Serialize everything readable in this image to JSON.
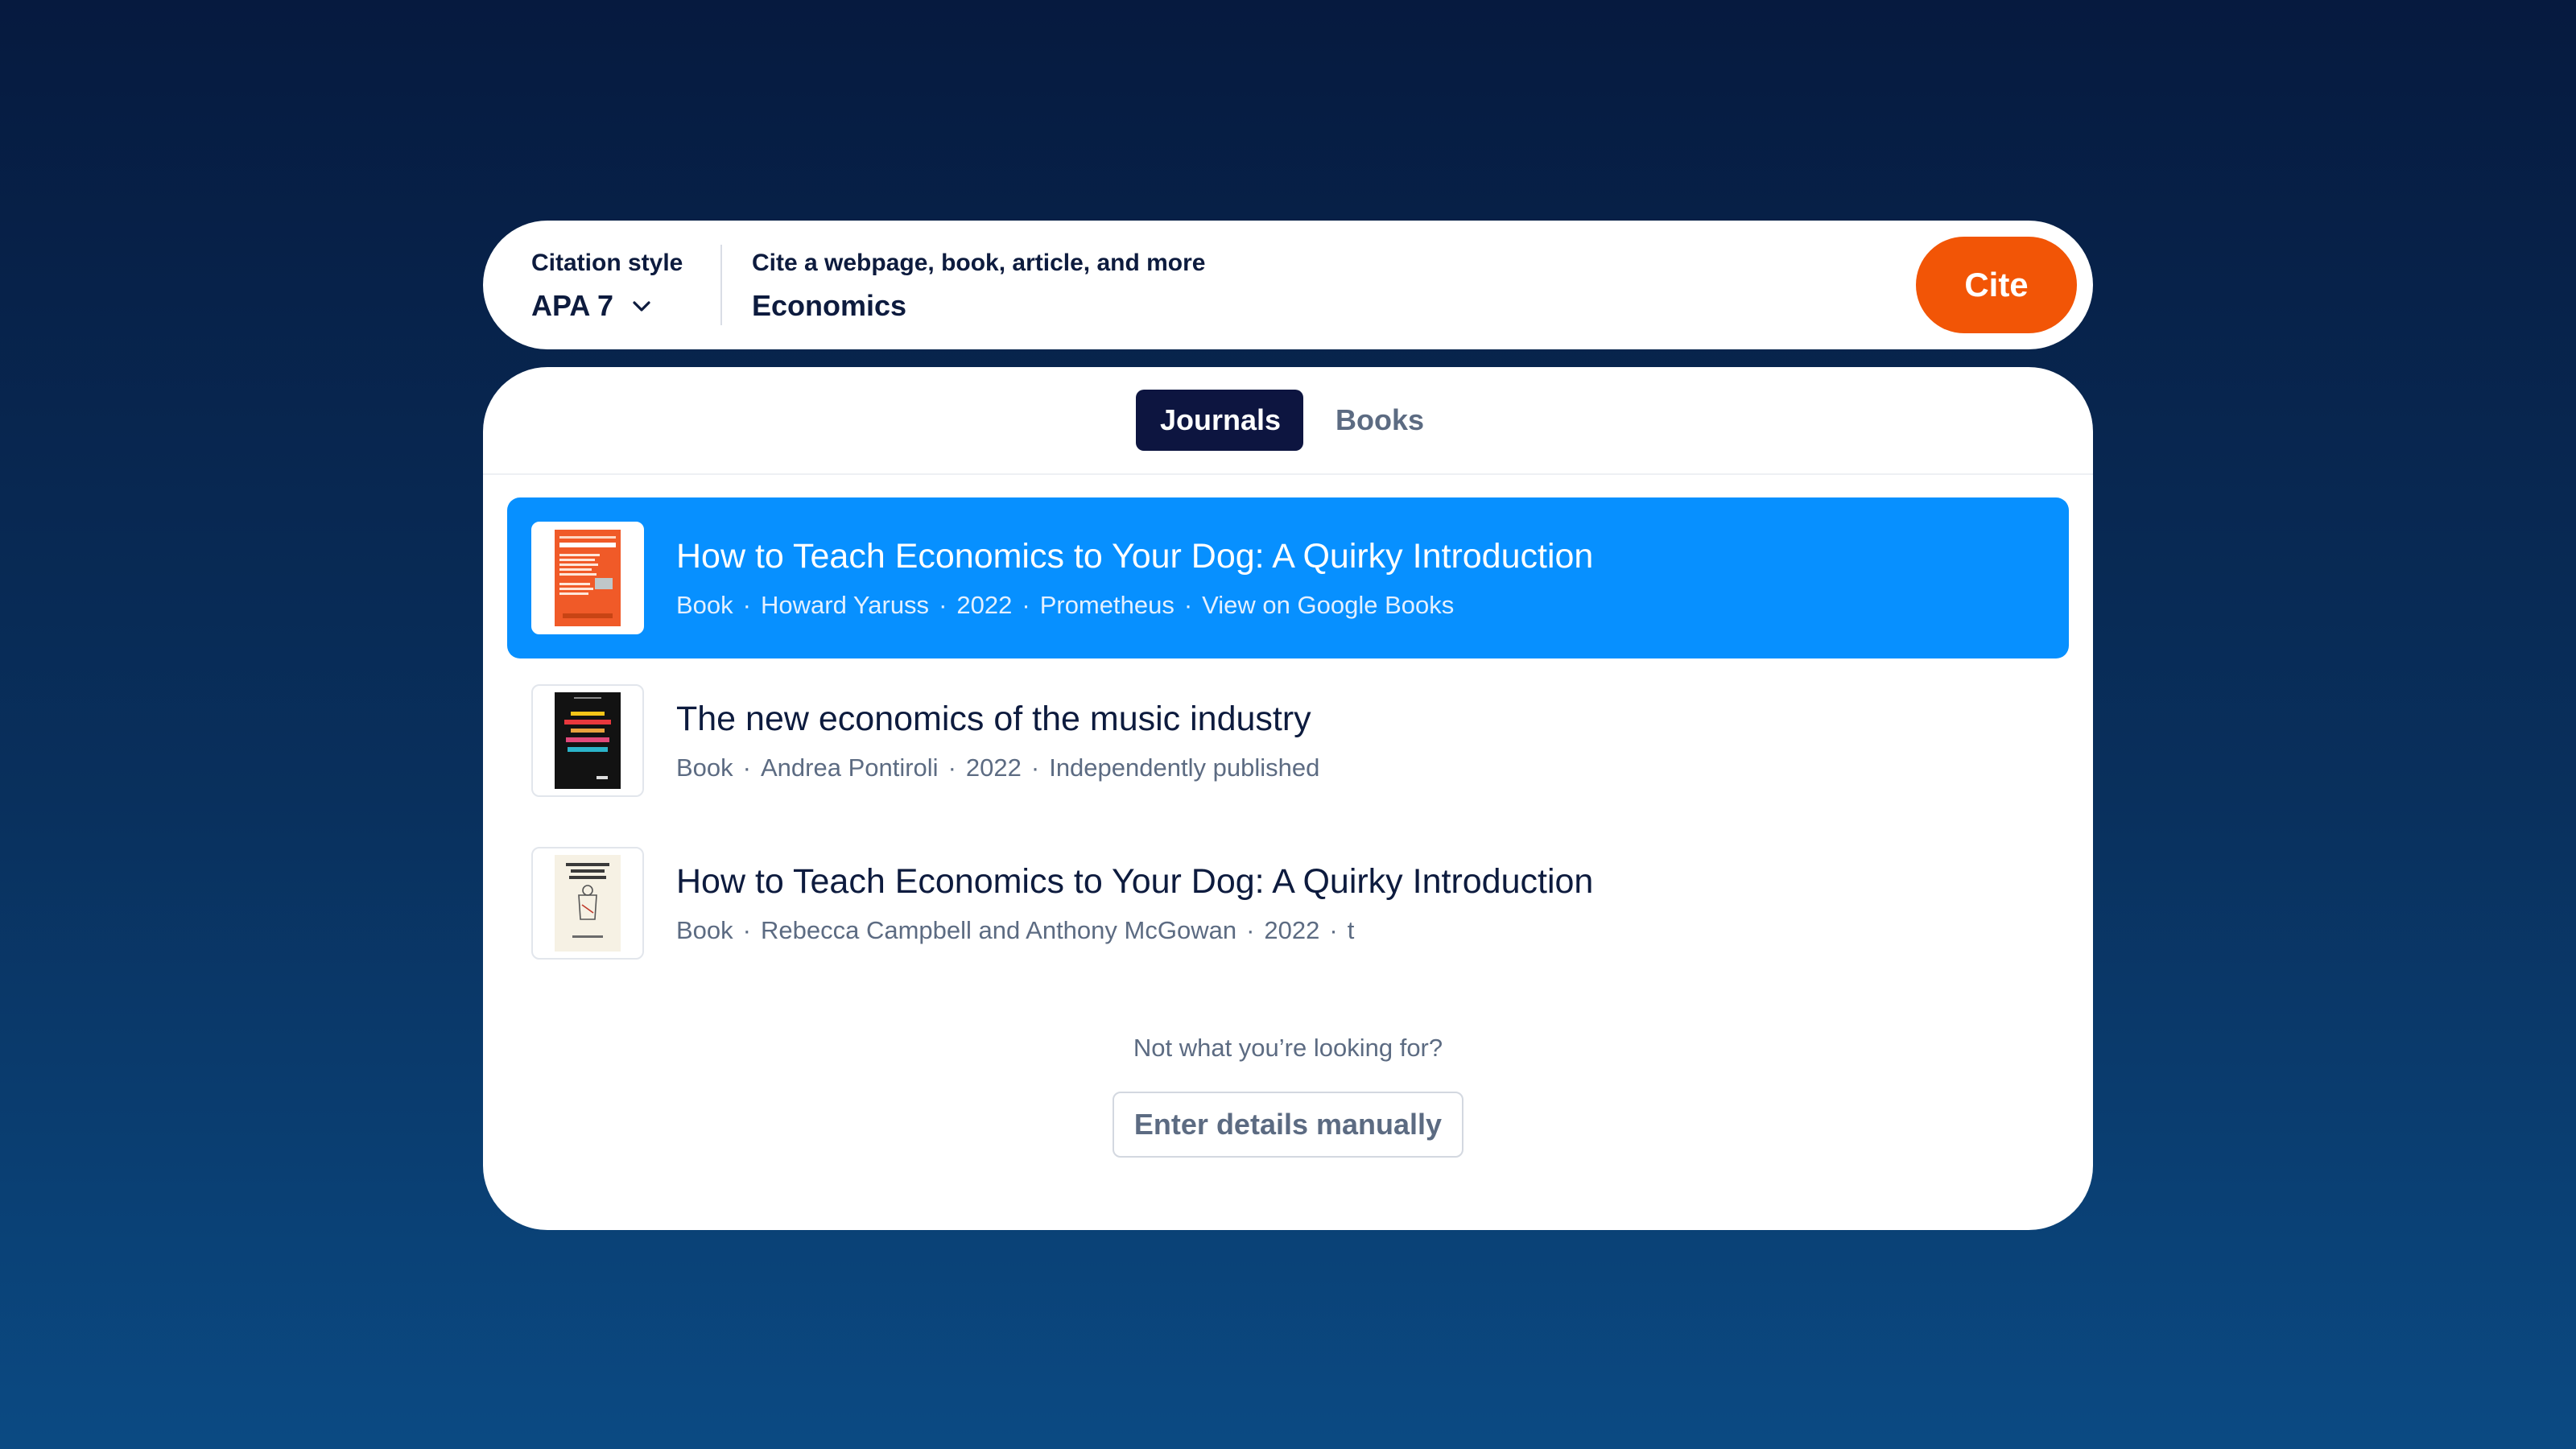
{
  "search": {
    "style_label": "Citation style",
    "style_value": "APA 7",
    "query_label": "Cite a webpage, book, article, and more",
    "query_value": "Economics",
    "cite_label": "Cite"
  },
  "tabs": [
    {
      "label": "Journals",
      "active": true
    },
    {
      "label": "Books",
      "active": false
    }
  ],
  "results": [
    {
      "title": "How to Teach Economics to Your Dog: A Quirky Introduction",
      "meta": [
        "Book",
        "Howard Yaruss",
        "2022",
        "Prometheus",
        "View on Google Books"
      ],
      "highlighted": true
    },
    {
      "title": "The new economics of the music industry",
      "meta": [
        "Book",
        "Andrea Pontiroli",
        "2022",
        "Independently published"
      ],
      "highlighted": false
    },
    {
      "title": "How to Teach Economics to Your Dog: A Quirky Introduction",
      "meta": [
        "Book",
        "Rebecca Campbell and Anthony McGowan",
        "2022",
        "t"
      ],
      "highlighted": false
    }
  ],
  "footer": {
    "prompt": "Not what you’re looking for?",
    "manual_label": "Enter details manually"
  },
  "colors": {
    "accent": "#f25506",
    "highlight": "#0790ff",
    "active_tab": "#0d1540"
  }
}
